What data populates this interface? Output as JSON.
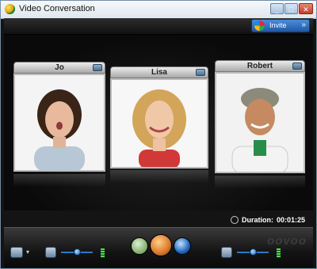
{
  "window": {
    "title": "Video Conversation",
    "controls": [
      "minimize",
      "maximize",
      "close"
    ]
  },
  "toolbar": {
    "invite_label": "Invite",
    "invite_chevron": "»"
  },
  "participants": [
    {
      "name": "Jo",
      "status": "camera-on"
    },
    {
      "name": "Lisa",
      "status": "camera-on"
    },
    {
      "name": "Robert",
      "status": "camera-on"
    }
  ],
  "duration": {
    "label": "Duration:",
    "value": "00:01:25"
  },
  "controls": {
    "video_settings_icon": "eye-icon",
    "mic_icon": "microphone-icon",
    "mic_volume": 0.5,
    "center_buttons": [
      "send-file",
      "end-call",
      "status"
    ],
    "speaker_icon": "speaker-icon",
    "speaker_volume": 0.5
  },
  "brand": {
    "logo_text": "oovoo",
    "accent": "#2c77c9",
    "end_call_color": "#d9782a"
  }
}
